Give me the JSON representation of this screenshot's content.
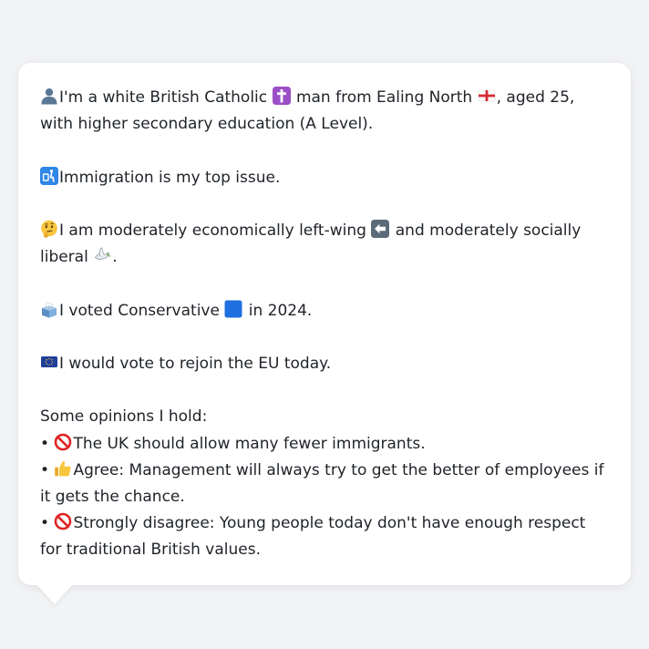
{
  "card": {
    "line1": {
      "part1": "I'm a white British Catholic",
      "part2": "man from Ealing North",
      "part3": ", aged 25, with higher secondary education (A Level)."
    },
    "line2": "Immigration is my top issue.",
    "line3": {
      "part1": "I am moderately economically left-wing",
      "part2": "and moderately socially liberal",
      "part3": "."
    },
    "line4": {
      "part1": "I voted Conservative",
      "part2": "in 2024."
    },
    "line5": "I would vote to rejoin the EU today.",
    "opinions_header": "Some opinions I hold:",
    "opinions": [
      "The UK should allow many fewer immigrants.",
      "Agree: Management will always try to get the better of employees if it gets the chance.",
      "Strongly disagree: Young people today don't have enough respect for traditional British values."
    ],
    "bullet": "•"
  },
  "icons": {
    "person": "person-icon",
    "cross": "latin-cross-icon",
    "flag": "england-flag-icon",
    "passport": "passport-control-icon",
    "thinking": "thinking-face-icon",
    "left_arrow": "left-arrow-icon",
    "dove": "dove-icon",
    "ballot": "ballot-box-icon",
    "blue_square": "blue-square-icon",
    "eu_flag": "eu-flag-icon",
    "prohibited": "prohibited-icon",
    "thumbs_up": "thumbs-up-icon"
  },
  "colors": {
    "background": "#f2f3f5",
    "card": "#ffffff",
    "text": "#1f2328",
    "conservative_blue": "#1f6fe0"
  }
}
